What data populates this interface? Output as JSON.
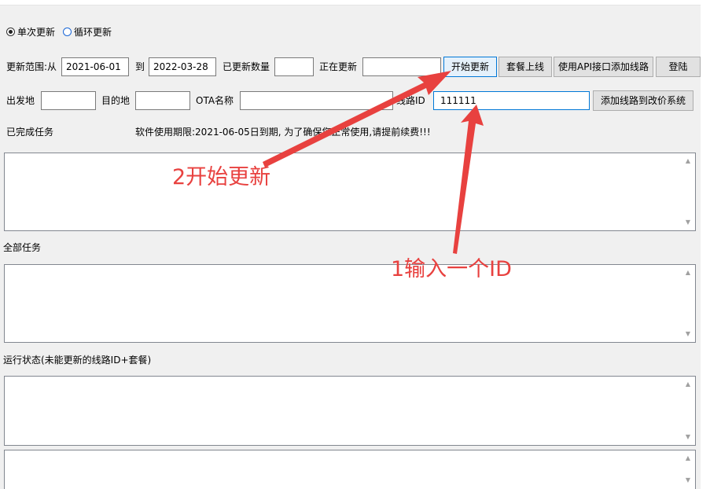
{
  "mode": {
    "single": "单次更新",
    "loop": "循环更新"
  },
  "range": {
    "label_from": "更新范围:从",
    "from": "2021-06-01",
    "label_to": "到",
    "to": "2022-03-28"
  },
  "updated_count": {
    "label": "已更新数量",
    "value": ""
  },
  "updating": {
    "label": "正在更新",
    "value": ""
  },
  "buttons": {
    "start": "开始更新",
    "package_online": "套餐上线",
    "api_add": "使用API接口添加线路",
    "login": "登陆",
    "add_route": "添加线路到改价系统"
  },
  "route": {
    "departure_label": "出发地",
    "departure": "",
    "destination_label": "目的地",
    "destination": "",
    "ota_label": "OTA名称",
    "ota": "",
    "route_id_label": "线路ID",
    "route_id": "111111"
  },
  "completed_label": "已完成任务",
  "notice": "软件使用期限:2021-06-05日到期,   为了确保您正常使用,请提前续费!!!",
  "all_tasks_label": "全部任务",
  "status_label": "运行状态(未能更新的线路ID+套餐)",
  "annotations": {
    "step2": "2开始更新",
    "step1": "1输入一个ID"
  },
  "colors": {
    "annotation": "#e8413f",
    "focus": "#0078d7"
  },
  "icons": {
    "scroll_up": "▲",
    "scroll_down": "▼"
  }
}
